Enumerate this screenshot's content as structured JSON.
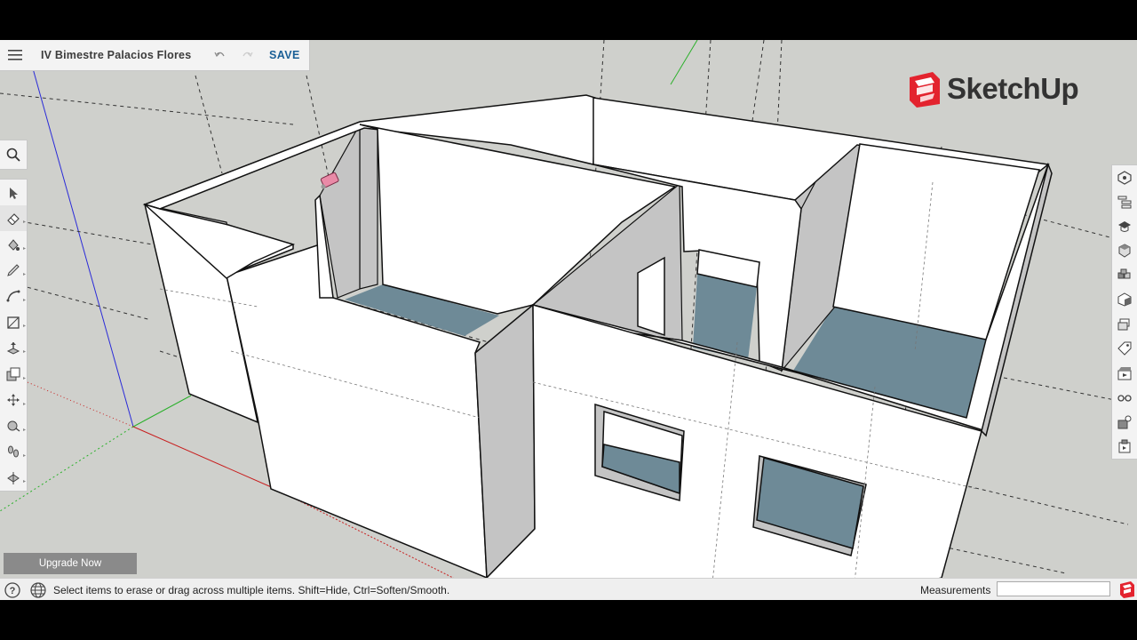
{
  "app": {
    "title": "IV Bimestre Palacios Flores",
    "save_label": "SAVE",
    "brand": "SketchUp",
    "upgrade_label": "Upgrade Now"
  },
  "status": {
    "hint": "Select items to erase or drag across multiple items. Shift=Hide, Ctrl=Soften/Smooth.",
    "measurements_label": "Measurements",
    "measurements_value": ""
  },
  "left_tools": [
    {
      "name": "select-icon",
      "active": false
    },
    {
      "name": "eraser-icon",
      "active": true
    },
    {
      "name": "paint-bucket-icon",
      "active": false
    },
    {
      "name": "pencil-icon",
      "active": false
    },
    {
      "name": "arc-icon",
      "active": false
    },
    {
      "name": "rectangle-icon",
      "active": false
    },
    {
      "name": "push-pull-icon",
      "active": false
    },
    {
      "name": "offset-icon",
      "active": false
    },
    {
      "name": "move-icon",
      "active": false
    },
    {
      "name": "tape-measure-icon",
      "active": false
    },
    {
      "name": "walk-icon",
      "active": false
    },
    {
      "name": "section-plane-icon",
      "active": false
    }
  ],
  "right_tools": [
    "entity-info-icon",
    "outliner-icon",
    "instructor-icon",
    "components-icon",
    "materials-icon",
    "styles-icon",
    "layers-icon",
    "tags-icon",
    "scenes-icon",
    "display-icon",
    "solar-icon",
    "extension-icon"
  ],
  "colors": {
    "canvas": "#cfd0cc",
    "wall": "#ffffff",
    "wall_side": "#c4c4c4",
    "floor": "#6e8a97",
    "brand_red": "#e3232e",
    "save_blue": "#1a5f96"
  }
}
